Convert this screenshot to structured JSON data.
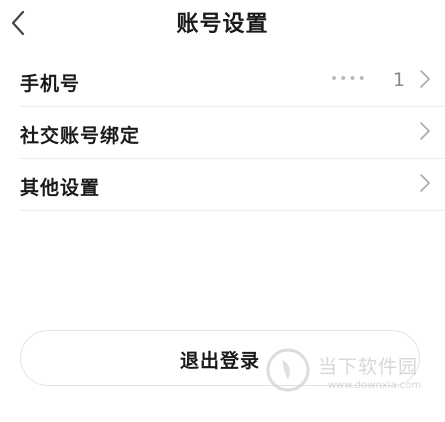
{
  "header": {
    "title": "账号设置"
  },
  "rows": [
    {
      "label": "手机号",
      "value_mask": "••••",
      "value_tail": "1"
    },
    {
      "label": "社交账号绑定"
    },
    {
      "label": "其他设置"
    }
  ],
  "logout": {
    "label": "退出登录"
  },
  "watermark": {
    "text": "当下软件园",
    "url": "www.downxia.com"
  }
}
